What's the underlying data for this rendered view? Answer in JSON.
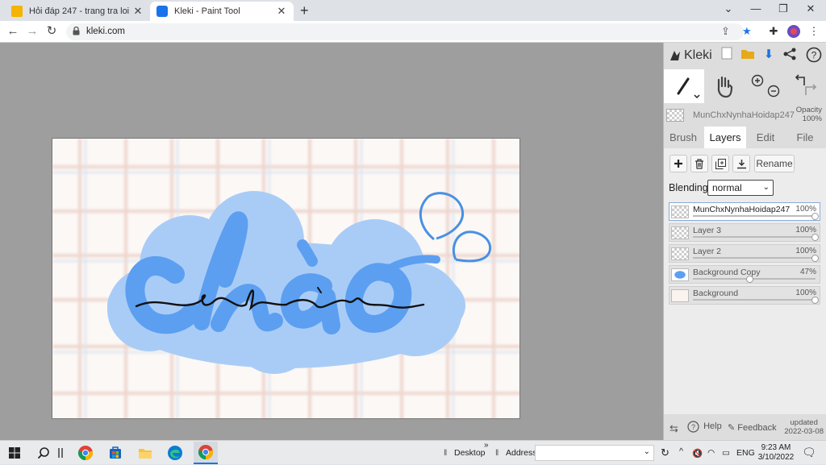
{
  "browser": {
    "tabs": [
      {
        "title": "Hỏi đáp 247 - trang tra loi",
        "active": false
      },
      {
        "title": "Kleki - Paint Tool",
        "active": true
      }
    ],
    "url": "kleki.com"
  },
  "app": {
    "brand": "Kleki",
    "layer_header": {
      "name": "MunChxNynhaHoidap247",
      "opacity_label": "Opacity",
      "opacity_value": "100%"
    },
    "tabs": [
      "Brush",
      "Layers",
      "Edit",
      "File"
    ],
    "active_tab": "Layers",
    "rename_label": "Rename",
    "blending_label": "Blending",
    "blending_value": "normal",
    "layers": [
      {
        "name": "MunChxNynhaHoidap247",
        "opacity": "100%",
        "opacity_value": 1.0,
        "selected": true
      },
      {
        "name": "Layer 3",
        "opacity": "100%",
        "opacity_value": 1.0,
        "selected": false
      },
      {
        "name": "Layer 2",
        "opacity": "100%",
        "opacity_value": 1.0,
        "selected": false
      },
      {
        "name": "Background Copy",
        "opacity": "47%",
        "opacity_value": 0.47,
        "selected": false
      },
      {
        "name": "Background",
        "opacity": "100%",
        "opacity_value": 1.0,
        "selected": false
      }
    ],
    "footer": {
      "help": "Help",
      "feedback": "Feedback",
      "updated_label": "updated",
      "updated_date": "2022-03-08"
    }
  },
  "taskbar": {
    "desktop_label": "Desktop",
    "address_label": "Address",
    "lang": "ENG",
    "time": "9:23 AM",
    "date": "3/10/2022"
  },
  "colors": {
    "accent": "#1a73e8",
    "light_blue": "#a9ccf7",
    "mid_blue": "#5c9ff0"
  }
}
